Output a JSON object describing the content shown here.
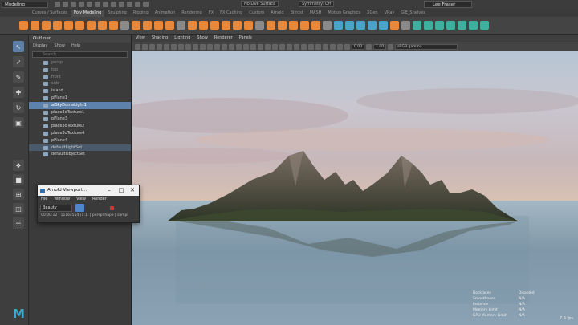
{
  "top": {
    "mode": "Modeling",
    "live_surface": "No Live Surface",
    "symmetry": "Symmetry: Off",
    "user": "Lee Fraser"
  },
  "shelf_tabs": [
    "Curves / Surfaces",
    "Poly Modeling",
    "Sculpting",
    "Rigging",
    "Animation",
    "Rendering",
    "FX",
    "FX Caching",
    "Custom",
    "Arnold",
    "Bifrost",
    "MASH",
    "Motion Graphics",
    "XGen",
    "VRay",
    "GIE_Shelves"
  ],
  "shelf_active": 1,
  "shelf_colors": {
    "orange": "#e8883a",
    "blue": "#4aa3c8",
    "teal": "#3fb0a0",
    "gray": "#8a8a8a"
  },
  "outliner": {
    "title": "Outliner",
    "menus": [
      "Display",
      "Show",
      "Help"
    ],
    "search_placeholder": "Search...",
    "items": [
      {
        "label": "persp",
        "state": "dim"
      },
      {
        "label": "top",
        "state": "dim"
      },
      {
        "label": "front",
        "state": "dim"
      },
      {
        "label": "side",
        "state": "dim"
      },
      {
        "label": "island",
        "state": "normal"
      },
      {
        "label": "pPlane1",
        "state": "normal"
      },
      {
        "label": "aiSkyDomeLight1",
        "state": "selected"
      },
      {
        "label": "place3dTexture1",
        "state": "normal"
      },
      {
        "label": "pPlane3",
        "state": "normal"
      },
      {
        "label": "place3dTexture2",
        "state": "normal"
      },
      {
        "label": "place3dTexture4",
        "state": "normal"
      },
      {
        "label": "pPlane4",
        "state": "normal"
      },
      {
        "label": "defaultLightSet",
        "state": "highlight"
      },
      {
        "label": "defaultObjectSet",
        "state": "normal"
      }
    ]
  },
  "viewport": {
    "menus": [
      "View",
      "Shading",
      "Lighting",
      "Show",
      "Renderer",
      "Panels"
    ],
    "field_a": "0.00",
    "field_b": "1.00",
    "colorspace": "sRGB gamma",
    "hud_labels": [
      "Backfaces",
      "Smoothness",
      "Instance",
      "Memory Limit",
      "GPU Memory Limit"
    ],
    "hud_values": [
      "Disabled",
      "N/A",
      "N/A",
      "N/A",
      "N/A"
    ],
    "fps": "7.9 fps"
  },
  "arnold": {
    "title": "Arnold Viewport...",
    "menus": [
      "File",
      "Window",
      "View",
      "Render"
    ],
    "aov": "Beauty",
    "status": "00:00:12 | 1116x554 (1:1) | perspShape | sampl"
  }
}
